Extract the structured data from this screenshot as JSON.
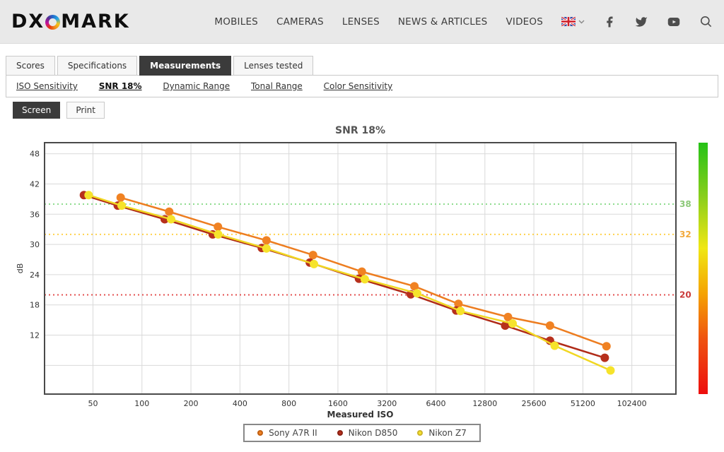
{
  "header": {
    "logo_left": "DX",
    "logo_right": "MARK",
    "nav": [
      "MOBILES",
      "CAMERAS",
      "LENSES",
      "NEWS & ARTICLES",
      "VIDEOS"
    ]
  },
  "tabs": {
    "items": [
      {
        "label": "Scores",
        "active": false
      },
      {
        "label": "Specifications",
        "active": false
      },
      {
        "label": "Measurements",
        "active": true
      },
      {
        "label": "Lenses tested",
        "active": false
      }
    ]
  },
  "subnav": {
    "items": [
      {
        "label": "ISO Sensitivity",
        "active": false
      },
      {
        "label": "SNR 18%",
        "active": true
      },
      {
        "label": "Dynamic Range",
        "active": false
      },
      {
        "label": "Tonal Range",
        "active": false
      },
      {
        "label": "Color Sensitivity",
        "active": false
      }
    ]
  },
  "view_toggle": {
    "screen": "Screen",
    "print": "Print"
  },
  "chart_data": {
    "type": "line",
    "title": "SNR 18%",
    "xlabel": "Measured ISO",
    "ylabel": "dB",
    "x_scale": "log2",
    "x_range": [
      25.2,
      191000
    ],
    "y_range": [
      0.3,
      50.2
    ],
    "x_ticks": [
      50,
      100,
      200,
      400,
      800,
      1600,
      3200,
      6400,
      12800,
      25600,
      51200,
      102400
    ],
    "y_ticks": [
      12,
      18,
      24,
      30,
      36,
      42,
      48
    ],
    "y_gridlines": [
      6,
      12,
      18,
      24,
      30,
      36,
      42,
      48
    ],
    "grid_color": "#d9d9d9",
    "plot_border_color": "#4a4a4a",
    "reference_lines": [
      {
        "value": 38,
        "label": "38",
        "color": "#8fdc8f",
        "label_color": "#8cc878"
      },
      {
        "value": 32,
        "label": "32",
        "color": "#ffd24d",
        "label_color": "#f2a93b"
      },
      {
        "value": 20,
        "label": "20",
        "color": "#e35050",
        "label_color": "#ca3b3b"
      }
    ],
    "gradient_bar": {
      "stops": [
        {
          "offset": "0%",
          "color": "#25c217"
        },
        {
          "offset": "22%",
          "color": "#8ccf1c"
        },
        {
          "offset": "42%",
          "color": "#f0e713"
        },
        {
          "offset": "60%",
          "color": "#f5a302"
        },
        {
          "offset": "78%",
          "color": "#ef5310"
        },
        {
          "offset": "100%",
          "color": "#ed0e0e"
        }
      ]
    },
    "legend_position": "bottom",
    "series": [
      {
        "name": "Sony A7R II",
        "color": "#ed7d20",
        "marker_fill": "#f08223",
        "legend_border": "#c05f12",
        "points": [
          [
            74,
            39.3
          ],
          [
            147,
            36.5
          ],
          [
            293,
            33.5
          ],
          [
            582,
            30.8
          ],
          [
            1125,
            27.9
          ],
          [
            2245,
            24.6
          ],
          [
            4720,
            21.7
          ],
          [
            8800,
            18.2
          ],
          [
            17750,
            15.6
          ],
          [
            32150,
            13.9
          ],
          [
            71500,
            9.8
          ]
        ]
      },
      {
        "name": "Nikon D850",
        "color": "#b02b18",
        "marker_fill": "#b7301c",
        "legend_border": "#8a2113",
        "points": [
          [
            44,
            39.8
          ],
          [
            71,
            37.7
          ],
          [
            138,
            35.0
          ],
          [
            272,
            32.0
          ],
          [
            545,
            29.3
          ],
          [
            1075,
            26.4
          ],
          [
            2155,
            23.2
          ],
          [
            4485,
            20.1
          ],
          [
            8530,
            16.9
          ],
          [
            17050,
            13.9
          ],
          [
            32150,
            10.9
          ],
          [
            69800,
            7.5
          ]
        ]
      },
      {
        "name": "Nikon Z7",
        "color": "#f1d722",
        "marker_fill": "#f6e32b",
        "legend_border": "#cdb42a",
        "points": [
          [
            47,
            39.8
          ],
          [
            75,
            37.7
          ],
          [
            151,
            35.0
          ],
          [
            294,
            32.0
          ],
          [
            582,
            29.2
          ],
          [
            1140,
            26.1
          ],
          [
            2340,
            23.1
          ],
          [
            4910,
            20.3
          ],
          [
            9050,
            16.8
          ],
          [
            18950,
            14.3
          ],
          [
            34350,
            9.9
          ],
          [
            75700,
            5.0
          ]
        ]
      }
    ]
  }
}
